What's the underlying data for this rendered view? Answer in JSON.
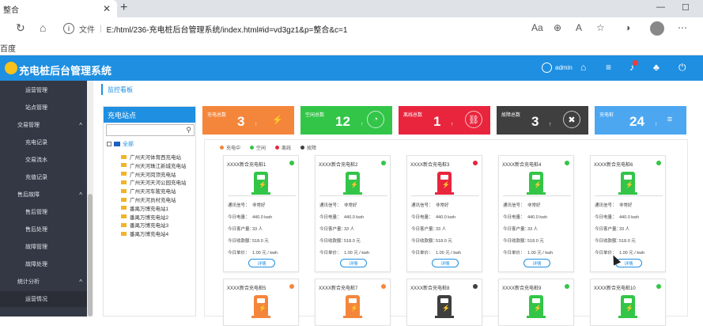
{
  "browser": {
    "tab_title": "整合",
    "address_label": "文件",
    "url": "E:/html/236-充电桩后台管理系统/index.html#id=vd3gz1&p=整合&c=1",
    "bookmark": "百度"
  },
  "app": {
    "title": "充电桩后台管理系统",
    "user": "admin"
  },
  "sidebar": {
    "items": [
      {
        "label": "运营管理",
        "type": "child"
      },
      {
        "label": "站点管理",
        "type": "child"
      },
      {
        "label": "交易管理",
        "type": "group"
      },
      {
        "label": "充电记录",
        "type": "child"
      },
      {
        "label": "交易流水",
        "type": "child"
      },
      {
        "label": "充值记录",
        "type": "child"
      },
      {
        "label": "售后故障",
        "type": "group"
      },
      {
        "label": "售后管理",
        "type": "child"
      },
      {
        "label": "售后处理",
        "type": "child"
      },
      {
        "label": "故障管理",
        "type": "child"
      },
      {
        "label": "故障处理",
        "type": "child"
      },
      {
        "label": "统计分析",
        "type": "group"
      },
      {
        "label": "运营情况",
        "type": "child"
      }
    ]
  },
  "breadcrumb": "监控看板",
  "tree": {
    "title": "充电站点",
    "root": "全部",
    "nodes": [
      "广州天河体育西充电站",
      "广州天河珠江新城充电站",
      "广州天河岗顶充电站",
      "广州天河天河公园充电站",
      "广州天河车陂充电站",
      "广州天河员村充电站",
      "番禺万博充电站1",
      "番禺万博充电站2",
      "番禺万博充电站3",
      "番禺万博充电站4"
    ]
  },
  "stats": [
    {
      "label": "充电总数",
      "value": "3",
      "color": "#f4863b",
      "icon": "bolt-icon"
    },
    {
      "label": "空闲总数",
      "value": "12",
      "color": "#33c548",
      "icon": "clock-icon"
    },
    {
      "label": "离线总数",
      "value": "1",
      "color": "#e9253d",
      "icon": "unlink-icon"
    },
    {
      "label": "故障总数",
      "value": "3",
      "color": "#3f3f3f",
      "icon": "wrench-icon"
    },
    {
      "label": "充电桩",
      "value": "24",
      "color": "#4da7f0",
      "icon": "list-icon"
    }
  ],
  "legend": [
    {
      "label": "充电中",
      "color": "#f4863b"
    },
    {
      "label": "空闲",
      "color": "#33c548"
    },
    {
      "label": "离线",
      "color": "#e9253d"
    },
    {
      "label": "故障",
      "color": "#3f3f3f"
    }
  ],
  "card_fields": {
    "signal": "通讯信号：",
    "signal_value": "非常好",
    "today_power": "今日电量：",
    "today_users": "今日客户量：",
    "today_income": "今日收款额：",
    "today_price": "今日单价：",
    "detail": "详情"
  },
  "piles": [
    {
      "name": "XXXX新合充电桩1",
      "color": "#33c548",
      "power": "440.0 kwh",
      "users": "33 人",
      "income": "518.0 元",
      "price": "1.00 元 / kwh"
    },
    {
      "name": "XXXX新合充电桩2",
      "color": "#33c548",
      "power": "440.0 kwh",
      "users": "33 人",
      "income": "518.0 元",
      "price": "1.00 元 / kwh"
    },
    {
      "name": "XXXX新合充电桩3",
      "color": "#e9253d",
      "power": "440.0 kwh",
      "users": "33 人",
      "income": "518.0 元",
      "price": "1.00 元 / kwh"
    },
    {
      "name": "XXXX新合充电桩4",
      "color": "#33c548",
      "power": "440.0 kwh",
      "users": "33 人",
      "income": "518.0 元",
      "price": "1.00 元 / kwh"
    },
    {
      "name": "XXXX新合充电桩6",
      "color": "#33c548",
      "power": "440.0 kwh",
      "users": "33 人",
      "income": "518.0 元",
      "price": "1.00 元 / kwh"
    },
    {
      "name": "XXXX新合充电桩5",
      "color": "#f4863b"
    },
    {
      "name": "XXXX新合充电桩7",
      "color": "#f4863b"
    },
    {
      "name": "XXXX新合充电桩8",
      "color": "#3f3f3f"
    },
    {
      "name": "XXXX新合充电桩9",
      "color": "#33c548"
    },
    {
      "name": "XXXX新合充电桩10",
      "color": "#33c548"
    }
  ]
}
